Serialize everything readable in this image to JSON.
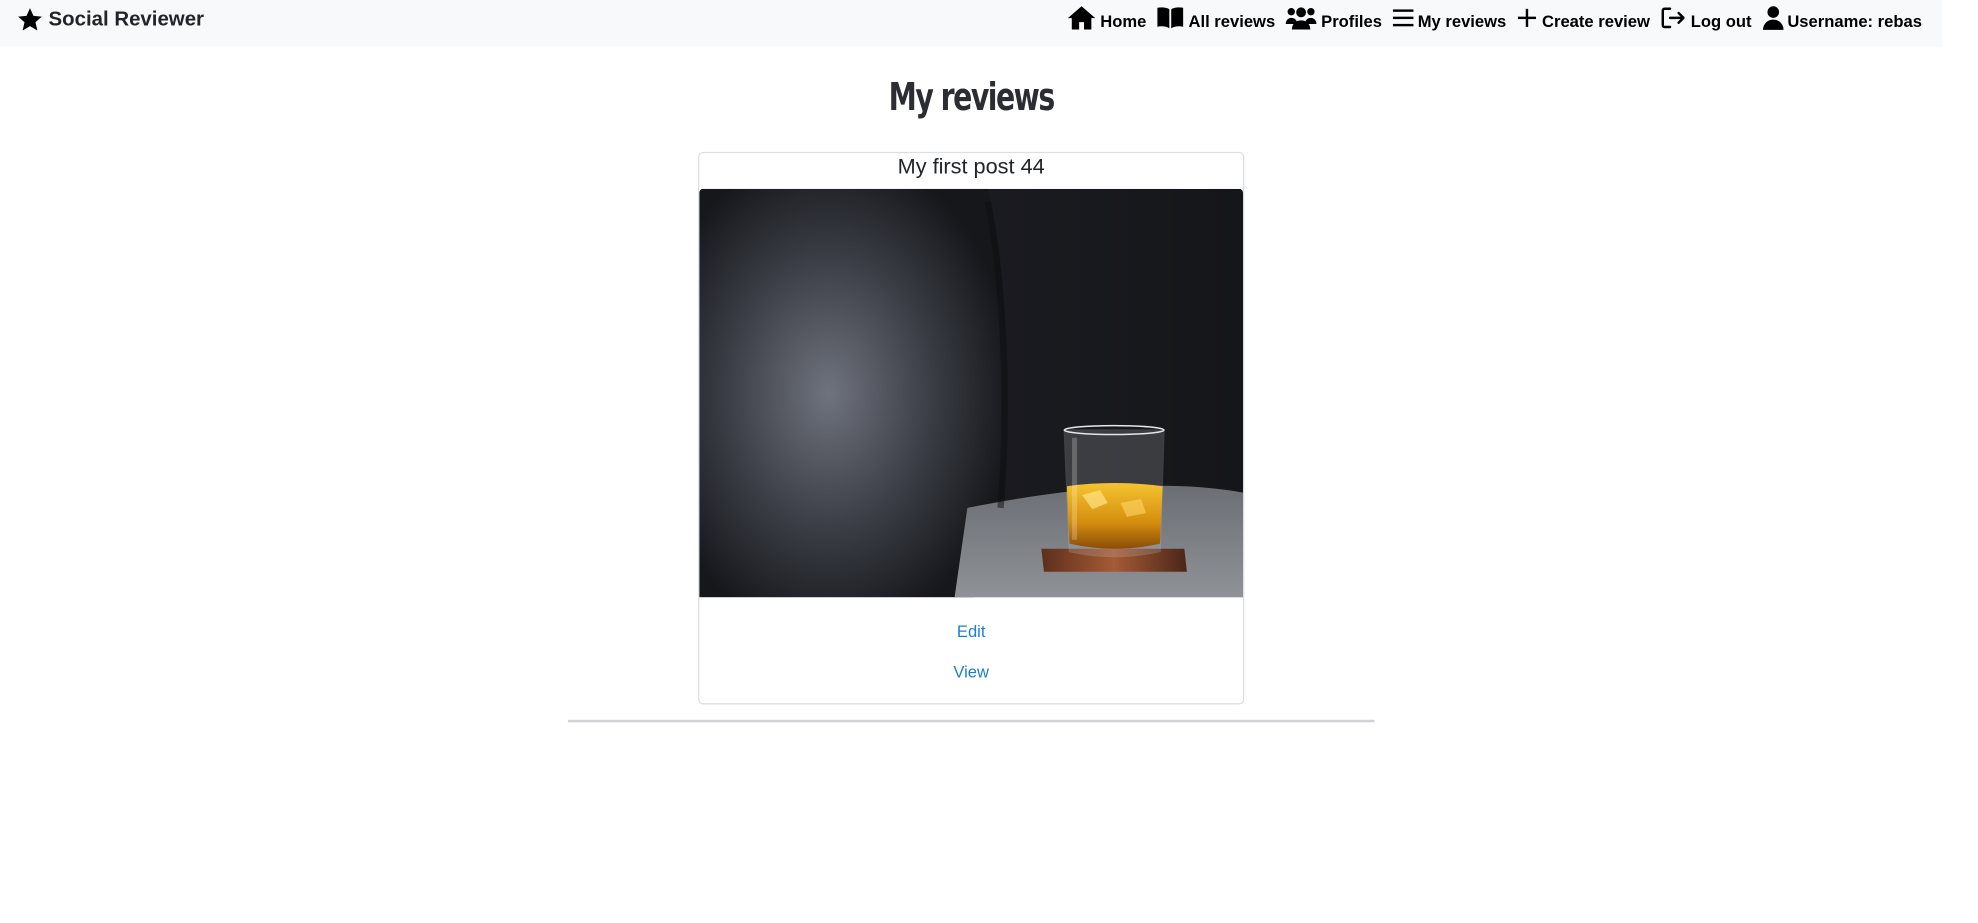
{
  "navbar": {
    "brand": {
      "label": "Social Reviewer",
      "icon": "star-icon"
    },
    "items": [
      {
        "label": "Home",
        "icon": "home-icon"
      },
      {
        "label": "All reviews",
        "icon": "book-icon"
      },
      {
        "label": "Profiles",
        "icon": "users-icon"
      },
      {
        "label": "My reviews",
        "icon": "list-icon"
      },
      {
        "label": "Create review",
        "icon": "plus-icon"
      },
      {
        "label": "Log out",
        "icon": "logout-icon"
      },
      {
        "label": "Username: rebas",
        "icon": "user-icon"
      }
    ]
  },
  "page": {
    "title": "My reviews"
  },
  "reviews": [
    {
      "title": "My first post 44",
      "image": "whiskey glass on a gray couch arm",
      "edit_label": "Edit",
      "view_label": "View"
    }
  ],
  "colors": {
    "navbar_bg": "#f8f9fa",
    "link": "#1a7fd4",
    "divider": "#d1d3d6"
  }
}
